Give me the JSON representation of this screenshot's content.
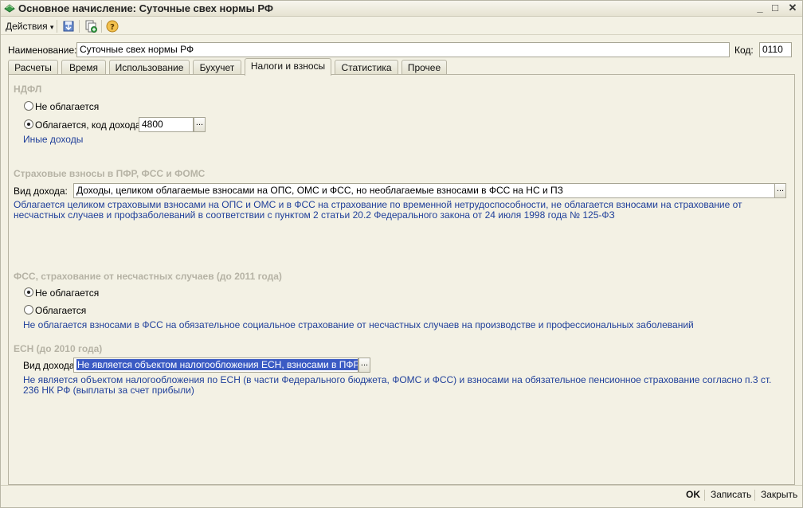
{
  "window": {
    "title": "Основное начисление: Суточные свех нормы РФ",
    "controls": {
      "minimize": "_",
      "maximize": "□",
      "close": "✕"
    }
  },
  "toolbar": {
    "actions_label": "Действия",
    "actions_arrow": "▾",
    "icons": [
      "save-icon",
      "copy-icon",
      "help-icon"
    ]
  },
  "header": {
    "name_label": "Наименование:",
    "name_value": "Суточные свех нормы РФ",
    "code_label": "Код:",
    "code_value": "0110"
  },
  "tabs": [
    {
      "label": "Расчеты"
    },
    {
      "label": "Время"
    },
    {
      "label": "Использование"
    },
    {
      "label": "Бухучет"
    },
    {
      "label": "Налоги и взносы",
      "active": true
    },
    {
      "label": "Статистика"
    },
    {
      "label": "Прочее"
    }
  ],
  "ndfl": {
    "title": "НДФЛ",
    "option_not_taxed": "Не облагается",
    "option_taxed": "Облагается, код дохода:",
    "selected": "taxed",
    "income_code": "4800",
    "picker": "...",
    "link": "Иные доходы"
  },
  "insurance": {
    "title": "Страховые взносы в ПФР, ФСС и ФОМС",
    "type_label": "Вид дохода:",
    "type_value": "Доходы, целиком облагаемые взносами на ОПС, ОМС и ФСС, но необлагаемые взносами в ФСС на НС и ПЗ",
    "picker": "...",
    "description": "Облагается целиком страховыми взносами на ОПС и ОМС и в ФСС на страхование по временной нетрудоспособности, не облагается взносами на страхование от несчастных случаев и профзаболеваний в соответствии с пунктом 2 статьи 20.2 Федерального закона от 24 июля 1998 года № 125-ФЗ"
  },
  "fss": {
    "title": "ФСС, страхование от несчастных случаев (до 2011 года)",
    "option_not_taxed": "Не облагается",
    "option_taxed": "Облагается",
    "selected": "not_taxed",
    "description": "Не облагается взносами в ФСС на обязательное социальное страхование от несчастных случаев на производстве и профессиональных заболеваний"
  },
  "esn": {
    "title": "ЕСН (до 2010 года)",
    "type_label": "Вид дохода:",
    "type_value": "Не является объектом налогообложения ЕСН, взносами в ПФР сог.",
    "picker": "...",
    "description": "Не является объектом налогообложения по ЕСН (в части Федерального бюджета, ФОМС и ФСС) и взносами на обязательное пенсионное страхование согласно п.3 ст. 236 НК РФ (выплаты за счет прибыли)"
  },
  "footer": {
    "ok_label": "OK",
    "save_label": "Записать",
    "close_label": "Закрыть"
  },
  "colors": {
    "background": "#f3f1e4",
    "section_title": "#b6b3a5",
    "link_text": "#1f3f9a",
    "selection": "#3b5bc4"
  }
}
